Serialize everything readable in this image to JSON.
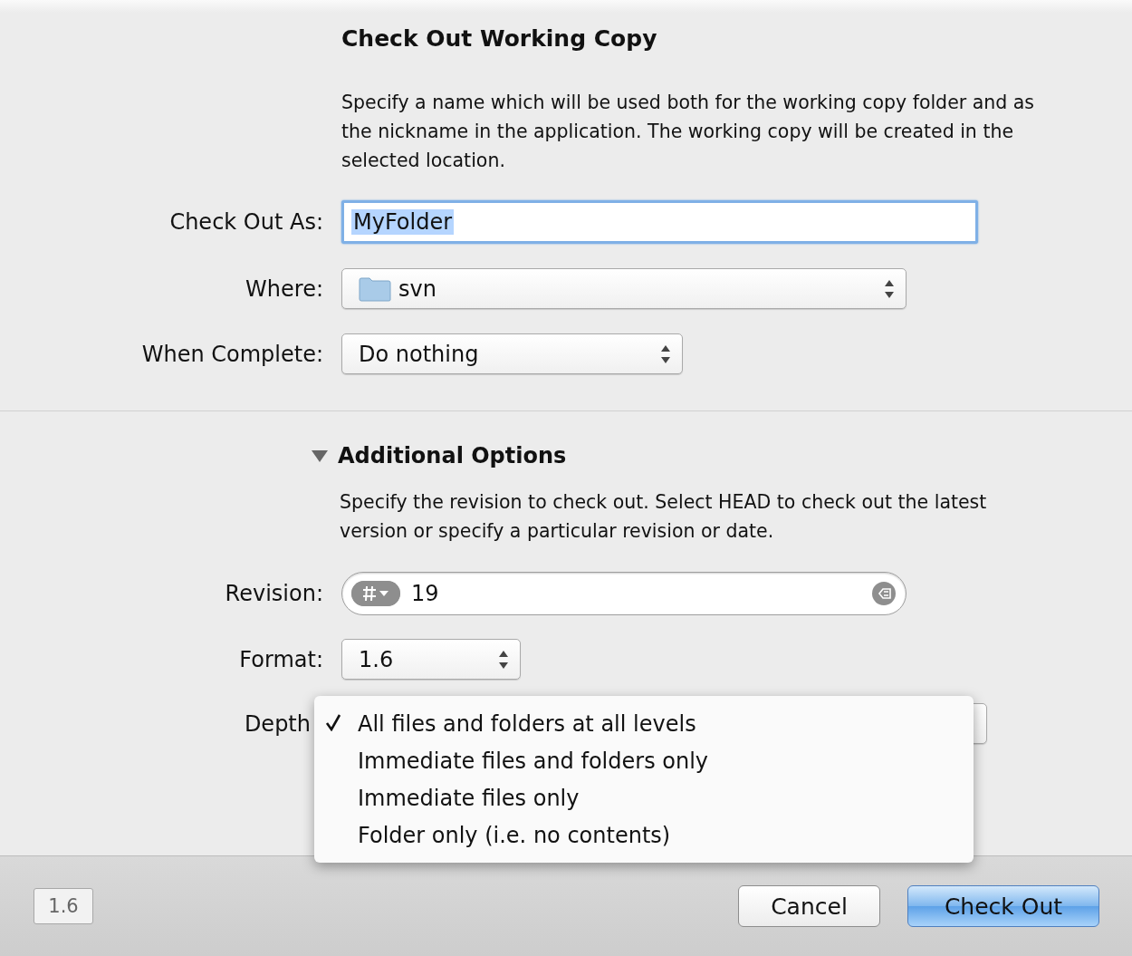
{
  "title": "Check Out Working Copy",
  "intro": "Specify a name which will be used both for the working copy folder and as the nickname in the application. The working copy will be created in the selected location.",
  "check_out_as": {
    "label": "Check Out As:",
    "value": "MyFolder",
    "text_selected": true
  },
  "where": {
    "label": "Where:",
    "value": "svn"
  },
  "when_complete": {
    "label": "When Complete:",
    "value": "Do nothing"
  },
  "additional_options": {
    "label": "Additional Options",
    "expanded": true,
    "description": "Specify the revision to check out. Select HEAD to check out the latest version or specify a particular revision or date."
  },
  "revision": {
    "label": "Revision:",
    "value": "19"
  },
  "format": {
    "label": "Format:",
    "value": "1.6"
  },
  "depth": {
    "label": "Depth",
    "menu": [
      {
        "label": "All files and folders at all levels",
        "selected": true
      },
      {
        "label": "Immediate files and folders only",
        "selected": false
      },
      {
        "label": "Immediate files only",
        "selected": false
      },
      {
        "label": "Folder only (i.e. no contents)",
        "selected": false
      }
    ]
  },
  "footer": {
    "version": "1.6",
    "buttons": [
      {
        "label": "Cancel",
        "default": false
      },
      {
        "label": "Check Out",
        "default": true
      }
    ]
  }
}
